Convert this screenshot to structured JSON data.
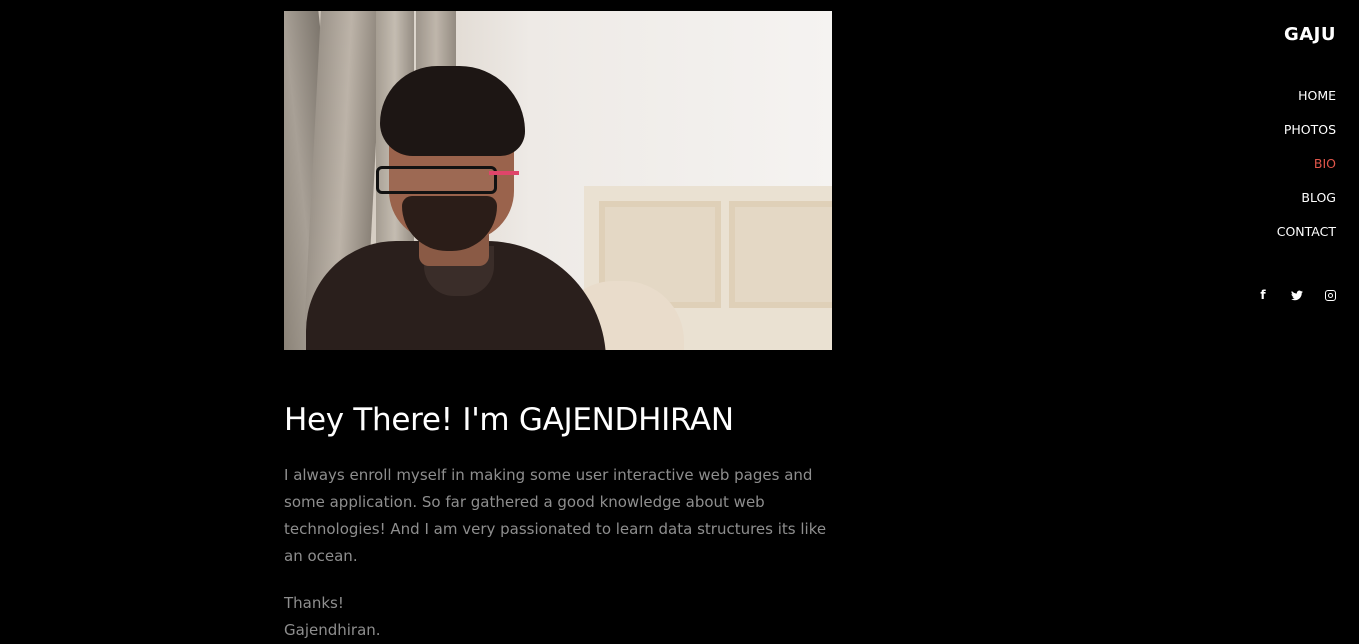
{
  "brand": "GAJU",
  "nav": [
    {
      "label": "HOME"
    },
    {
      "label": "PHOTOS"
    },
    {
      "label": "BIO",
      "active": true
    },
    {
      "label": "BLOG"
    },
    {
      "label": "CONTACT"
    }
  ],
  "social": [
    {
      "icon": "facebook-icon",
      "glyph": "f"
    },
    {
      "icon": "twitter-icon",
      "glyph": "🐦"
    },
    {
      "icon": "instagram-icon",
      "glyph": ""
    }
  ],
  "hero_image": {
    "alt": "Portrait photo"
  },
  "heading": "Hey There! I'm GAJENDHIRAN",
  "paragraph": "I always enroll myself in making some user interactive web pages and some application. So far gathered a good knowledge about web technologies! And I am very passionated to learn data structures its like an ocean.",
  "signoff": [
    "Thanks!",
    "Gajendhiran."
  ],
  "colors": {
    "background": "#000000",
    "accent": "#e0564a",
    "body_text": "#8e8e8e"
  }
}
